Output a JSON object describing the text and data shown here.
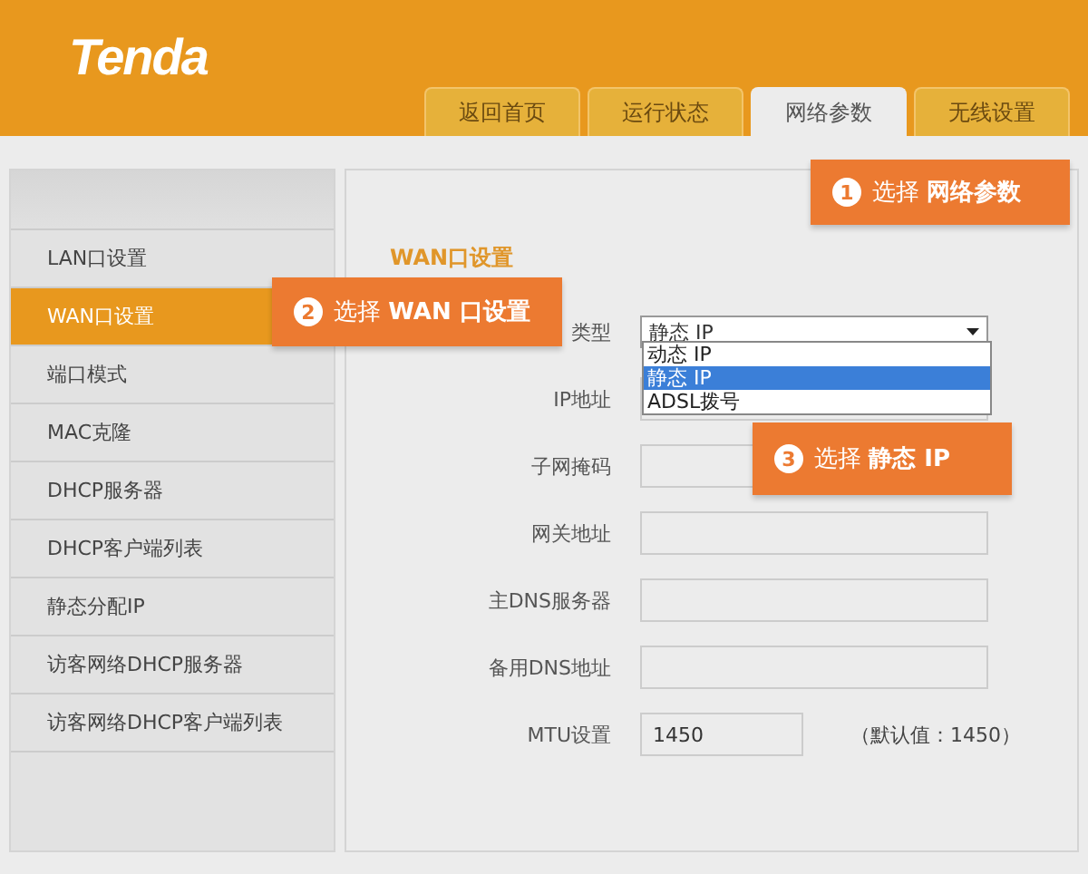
{
  "header": {
    "logo": "Tenda",
    "tabs": [
      {
        "label": "返回首页",
        "selected": false
      },
      {
        "label": "运行状态",
        "selected": false
      },
      {
        "label": "网络参数",
        "selected": true
      },
      {
        "label": "无线设置",
        "selected": false
      }
    ]
  },
  "sidebar": {
    "items": [
      {
        "label": "LAN口设置",
        "selected": false
      },
      {
        "label": "WAN口设置",
        "selected": true
      },
      {
        "label": "端口模式",
        "selected": false
      },
      {
        "label": "MAC克隆",
        "selected": false
      },
      {
        "label": "DHCP服务器",
        "selected": false
      },
      {
        "label": "DHCP客户端列表",
        "selected": false
      },
      {
        "label": "静态分配IP",
        "selected": false
      },
      {
        "label": "访客网络DHCP服务器",
        "selected": false
      },
      {
        "label": "访客网络DHCP客户端列表",
        "selected": false
      }
    ]
  },
  "form": {
    "title": "WAN口设置",
    "fields": [
      {
        "kind": "select",
        "label": "类型",
        "value": "静态 IP",
        "options": [
          {
            "label": "动态 IP",
            "selected": false
          },
          {
            "label": "静态 IP",
            "selected": true
          },
          {
            "label": "ADSL拨号",
            "selected": false
          }
        ]
      },
      {
        "kind": "input",
        "label": "IP地址"
      },
      {
        "kind": "input",
        "label": "子网掩码"
      },
      {
        "kind": "input",
        "label": "网关地址"
      },
      {
        "kind": "input",
        "label": "主DNS服务器"
      },
      {
        "kind": "input",
        "label": "备用DNS地址"
      },
      {
        "kind": "short",
        "label": "MTU设置",
        "value": "1450",
        "note": "（默认值：1450）"
      }
    ]
  },
  "callouts": [
    {
      "number": "1",
      "text": "选择 **网络参数**"
    },
    {
      "number": "2",
      "text": "选择 **WAN 口设置**"
    },
    {
      "number": "3",
      "text": "选择 **静态 IP**"
    }
  ]
}
